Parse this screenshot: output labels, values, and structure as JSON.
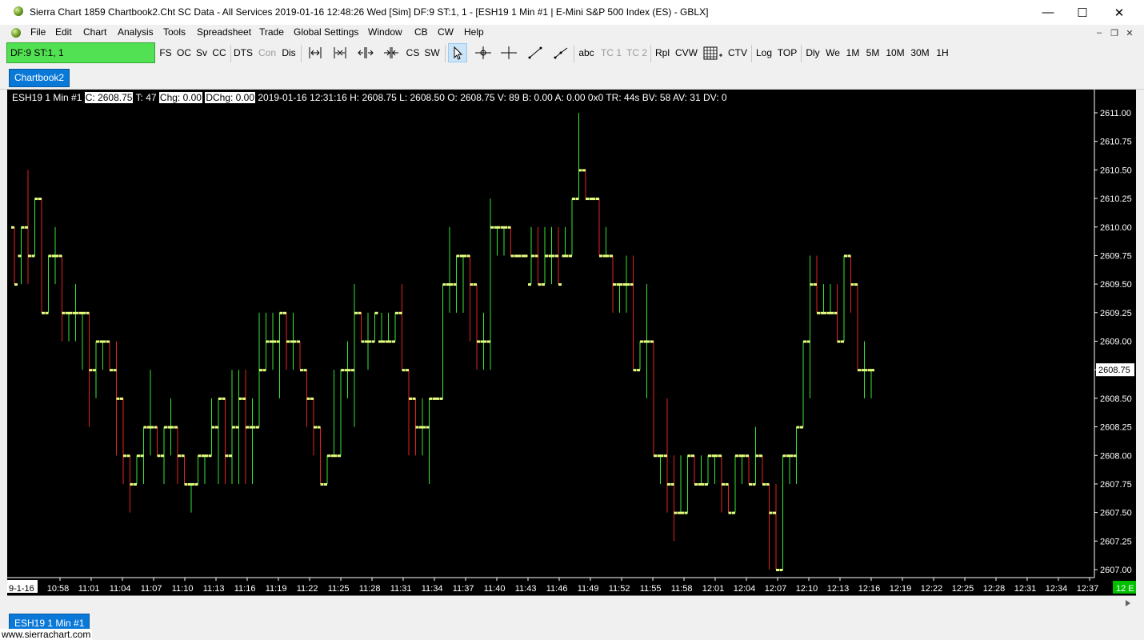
{
  "window": {
    "title": "Sierra Chart 1859 Chartbook2.Cht  SC Data - All Services 2019-01-16  12:48:26 Wed [Sim]  DF:9  ST:1, 1 - [ESH19  1 Min  #1 | E-Mini S&P 500 Index (ES) - GBLX]",
    "controls": {
      "minimize": "—",
      "maximize": "☐",
      "close": "✕"
    }
  },
  "menu": [
    "File",
    "Edit",
    "Chart",
    "Analysis",
    "Tools",
    "Spreadsheet",
    "Trade",
    "Global Settings",
    "Window",
    "CB",
    "CW",
    "Help"
  ],
  "mdi_controls": {
    "minimize": "–",
    "restore": "❐",
    "close": "✕"
  },
  "toolbar": {
    "df_status": "DF:9  ST:1, 1",
    "group1": [
      "FS",
      "OC",
      "Sv",
      "CC"
    ],
    "group2": [
      "DTS",
      "Con",
      "Dis"
    ],
    "group3": [
      "CS",
      "SW"
    ],
    "group4": [
      "abc",
      "TC 1",
      "TC 2"
    ],
    "group5": [
      "Rpl",
      "CVW"
    ],
    "group6": [
      "CTV"
    ],
    "group7": [
      "Log",
      "TOP"
    ],
    "group8": [
      "Dly",
      "We",
      "1M",
      "5M",
      "10M",
      "30M",
      "1H"
    ]
  },
  "tab": {
    "label": "Chartbook2"
  },
  "info_line": {
    "symbol": "ESH19  1 Min   #1",
    "close": "C: 2608.75",
    "ticks": " T: 47 ",
    "chg": "Chg: 0.00",
    "dchg": "DChg: 0.00",
    "rest": " 2019-01-16 12:31:16 H: 2608.75  L: 2608.50  O: 2608.75  V: 89  B: 0.00  A: 0.00 0x0  TR: 44s  BV: 58  AV: 31  DV: 0"
  },
  "bottom_tab": {
    "label": "ESH19  1 Min   #1"
  },
  "status_bar": {
    "url": "www.sierrachart.com"
  },
  "colors": {
    "chart_bg": "#000000",
    "up": "#33e633",
    "down": "#e62020",
    "tick": "#e6ff80",
    "axis_text": "#ffffff",
    "price_marker_bg": "#ffffff",
    "corner_badge": "#00c000",
    "df_box": "#52e152",
    "tab_active": "#0a78d7"
  },
  "chart_data": {
    "type": "ohlc",
    "symbol": "ESH19",
    "interval": "1 Min",
    "ylim": [
      2607.0,
      2611.0
    ],
    "y_ticks": [
      "2611.00",
      "2610.75",
      "2610.50",
      "2610.25",
      "2610.00",
      "2609.75",
      "2609.50",
      "2609.25",
      "2609.00",
      "2608.75",
      "2608.50",
      "2608.25",
      "2608.00",
      "2607.75",
      "2607.50",
      "2607.25",
      "2607.00"
    ],
    "current_price_label": "2608.75",
    "x_ticks": [
      "9-1-16",
      "10:58",
      "11:01",
      "11:04",
      "11:07",
      "11:10",
      "11:13",
      "11:16",
      "11:19",
      "11:22",
      "11:25",
      "11:28",
      "11:31",
      "11:34",
      "11:37",
      "11:40",
      "11:43",
      "11:46",
      "11:49",
      "11:52",
      "11:55",
      "11:58",
      "12:01",
      "12:04",
      "12:07",
      "12:10",
      "12:13",
      "12:16",
      "12:19",
      "12:22",
      "12:25",
      "12:28",
      "12:31",
      "12:34",
      "12:37"
    ],
    "corner_badge": "12 E",
    "bars": [
      {
        "o": 2610.0,
        "h": 2610.0,
        "l": 2609.5,
        "c": 2609.5
      },
      {
        "o": 2609.75,
        "h": 2610.0,
        "l": 2609.5,
        "c": 2610.0
      },
      {
        "o": 2610.0,
        "h": 2610.5,
        "l": 2609.5,
        "c": 2609.75
      },
      {
        "o": 2609.75,
        "h": 2610.25,
        "l": 2609.75,
        "c": 2610.25
      },
      {
        "o": 2610.25,
        "h": 2610.25,
        "l": 2609.25,
        "c": 2609.25
      },
      {
        "o": 2609.25,
        "h": 2609.75,
        "l": 2609.25,
        "c": 2609.75
      },
      {
        "o": 2609.75,
        "h": 2610.0,
        "l": 2609.5,
        "c": 2609.75
      },
      {
        "o": 2609.75,
        "h": 2609.75,
        "l": 2609.0,
        "c": 2609.25
      },
      {
        "o": 2609.25,
        "h": 2609.25,
        "l": 2609.0,
        "c": 2609.25
      },
      {
        "o": 2609.25,
        "h": 2609.5,
        "l": 2609.0,
        "c": 2609.25
      },
      {
        "o": 2609.25,
        "h": 2609.25,
        "l": 2608.75,
        "c": 2609.25
      },
      {
        "o": 2609.25,
        "h": 2609.25,
        "l": 2608.25,
        "c": 2608.75
      },
      {
        "o": 2608.75,
        "h": 2609.0,
        "l": 2608.5,
        "c": 2609.0
      },
      {
        "o": 2609.0,
        "h": 2609.0,
        "l": 2608.75,
        "c": 2609.0
      },
      {
        "o": 2609.0,
        "h": 2609.0,
        "l": 2608.75,
        "c": 2608.75
      },
      {
        "o": 2608.75,
        "h": 2609.0,
        "l": 2608.0,
        "c": 2608.5
      },
      {
        "o": 2608.5,
        "h": 2608.5,
        "l": 2607.75,
        "c": 2608.0
      },
      {
        "o": 2608.0,
        "h": 2608.0,
        "l": 2607.5,
        "c": 2607.75
      },
      {
        "o": 2607.75,
        "h": 2608.0,
        "l": 2607.75,
        "c": 2608.0
      },
      {
        "o": 2608.0,
        "h": 2608.25,
        "l": 2607.75,
        "c": 2608.25
      },
      {
        "o": 2608.25,
        "h": 2608.75,
        "l": 2608.0,
        "c": 2608.25
      },
      {
        "o": 2608.25,
        "h": 2608.25,
        "l": 2608.0,
        "c": 2608.0
      },
      {
        "o": 2608.0,
        "h": 2608.25,
        "l": 2607.75,
        "c": 2608.25
      },
      {
        "o": 2608.25,
        "h": 2608.5,
        "l": 2608.0,
        "c": 2608.25
      },
      {
        "o": 2608.25,
        "h": 2608.25,
        "l": 2607.75,
        "c": 2608.0
      },
      {
        "o": 2608.0,
        "h": 2608.0,
        "l": 2607.75,
        "c": 2607.75
      },
      {
        "o": 2607.75,
        "h": 2607.75,
        "l": 2607.5,
        "c": 2607.75
      },
      {
        "o": 2607.75,
        "h": 2608.0,
        "l": 2607.75,
        "c": 2608.0
      },
      {
        "o": 2608.0,
        "h": 2608.0,
        "l": 2607.75,
        "c": 2608.0
      },
      {
        "o": 2608.0,
        "h": 2608.5,
        "l": 2608.0,
        "c": 2608.25
      },
      {
        "o": 2608.25,
        "h": 2608.5,
        "l": 2607.75,
        "c": 2608.5
      },
      {
        "o": 2608.5,
        "h": 2608.5,
        "l": 2607.75,
        "c": 2608.0
      },
      {
        "o": 2608.0,
        "h": 2608.75,
        "l": 2607.75,
        "c": 2608.25
      },
      {
        "o": 2608.25,
        "h": 2608.75,
        "l": 2607.75,
        "c": 2608.5
      },
      {
        "o": 2608.5,
        "h": 2608.75,
        "l": 2607.75,
        "c": 2608.25
      },
      {
        "o": 2608.25,
        "h": 2608.5,
        "l": 2607.75,
        "c": 2608.25
      },
      {
        "o": 2608.25,
        "h": 2609.25,
        "l": 2608.25,
        "c": 2608.75
      },
      {
        "o": 2608.75,
        "h": 2609.25,
        "l": 2608.75,
        "c": 2609.0
      },
      {
        "o": 2609.0,
        "h": 2609.25,
        "l": 2608.75,
        "c": 2609.0
      },
      {
        "o": 2609.0,
        "h": 2609.25,
        "l": 2608.5,
        "c": 2609.25
      },
      {
        "o": 2609.25,
        "h": 2609.25,
        "l": 2608.75,
        "c": 2609.0
      },
      {
        "o": 2609.0,
        "h": 2609.25,
        "l": 2608.75,
        "c": 2609.0
      },
      {
        "o": 2609.0,
        "h": 2609.0,
        "l": 2608.75,
        "c": 2608.75
      },
      {
        "o": 2608.75,
        "h": 2608.75,
        "l": 2608.25,
        "c": 2608.5
      },
      {
        "o": 2608.5,
        "h": 2608.5,
        "l": 2608.0,
        "c": 2608.25
      },
      {
        "o": 2608.25,
        "h": 2608.25,
        "l": 2607.75,
        "c": 2607.75
      },
      {
        "o": 2607.75,
        "h": 2608.0,
        "l": 2607.75,
        "c": 2608.0
      },
      {
        "o": 2608.0,
        "h": 2608.75,
        "l": 2608.0,
        "c": 2608.0
      },
      {
        "o": 2608.0,
        "h": 2608.75,
        "l": 2608.0,
        "c": 2608.75
      },
      {
        "o": 2608.75,
        "h": 2609.0,
        "l": 2608.5,
        "c": 2608.75
      },
      {
        "o": 2608.75,
        "h": 2609.5,
        "l": 2608.25,
        "c": 2609.25
      },
      {
        "o": 2609.25,
        "h": 2609.25,
        "l": 2609.0,
        "c": 2609.0
      },
      {
        "o": 2609.0,
        "h": 2609.25,
        "l": 2608.75,
        "c": 2609.0
      },
      {
        "o": 2609.0,
        "h": 2609.25,
        "l": 2609.0,
        "c": 2609.25
      },
      {
        "o": 2609.0,
        "h": 2609.25,
        "l": 2609.0,
        "c": 2609.0
      },
      {
        "o": 2609.0,
        "h": 2609.25,
        "l": 2609.0,
        "c": 2609.0
      },
      {
        "o": 2609.0,
        "h": 2609.25,
        "l": 2609.0,
        "c": 2609.25
      },
      {
        "o": 2609.25,
        "h": 2609.5,
        "l": 2608.75,
        "c": 2608.75
      },
      {
        "o": 2608.75,
        "h": 2608.75,
        "l": 2608.0,
        "c": 2608.5
      },
      {
        "o": 2608.5,
        "h": 2608.5,
        "l": 2608.0,
        "c": 2608.25
      },
      {
        "o": 2608.25,
        "h": 2608.5,
        "l": 2608.0,
        "c": 2608.25
      },
      {
        "o": 2608.25,
        "h": 2608.5,
        "l": 2607.75,
        "c": 2608.5
      },
      {
        "o": 2608.5,
        "h": 2608.5,
        "l": 2608.5,
        "c": 2608.5
      },
      {
        "o": 2608.5,
        "h": 2609.5,
        "l": 2608.5,
        "c": 2609.5
      },
      {
        "o": 2609.5,
        "h": 2610.0,
        "l": 2609.25,
        "c": 2609.5
      },
      {
        "o": 2609.5,
        "h": 2609.75,
        "l": 2609.25,
        "c": 2609.75
      },
      {
        "o": 2609.75,
        "h": 2609.75,
        "l": 2609.25,
        "c": 2609.75
      },
      {
        "o": 2609.75,
        "h": 2609.75,
        "l": 2609.0,
        "c": 2609.5
      },
      {
        "o": 2609.5,
        "h": 2609.5,
        "l": 2608.75,
        "c": 2609.0
      },
      {
        "o": 2609.0,
        "h": 2609.25,
        "l": 2608.75,
        "c": 2609.0
      },
      {
        "o": 2609.0,
        "h": 2610.25,
        "l": 2608.75,
        "c": 2610.0
      },
      {
        "o": 2610.0,
        "h": 2610.0,
        "l": 2609.75,
        "c": 2610.0
      },
      {
        "o": 2610.0,
        "h": 2610.0,
        "l": 2609.75,
        "c": 2610.0
      },
      {
        "o": 2610.0,
        "h": 2610.0,
        "l": 2609.75,
        "c": 2609.75
      },
      {
        "o": 2609.75,
        "h": 2609.75,
        "l": 2609.75,
        "c": 2609.75
      },
      {
        "o": 2609.75,
        "h": 2609.75,
        "l": 2609.75,
        "c": 2609.75
      },
      {
        "o": 2609.5,
        "h": 2610.0,
        "l": 2609.5,
        "c": 2609.75
      },
      {
        "o": 2609.75,
        "h": 2610.0,
        "l": 2609.5,
        "c": 2609.5
      },
      {
        "o": 2609.5,
        "h": 2610.0,
        "l": 2609.5,
        "c": 2609.75
      },
      {
        "o": 2609.75,
        "h": 2610.0,
        "l": 2609.5,
        "c": 2609.75
      },
      {
        "o": 2609.75,
        "h": 2610.0,
        "l": 2609.5,
        "c": 2609.5
      },
      {
        "o": 2609.75,
        "h": 2610.0,
        "l": 2609.75,
        "c": 2609.75
      },
      {
        "o": 2609.75,
        "h": 2610.25,
        "l": 2609.75,
        "c": 2610.25
      },
      {
        "o": 2610.25,
        "h": 2611.0,
        "l": 2610.25,
        "c": 2610.5
      },
      {
        "o": 2610.5,
        "h": 2610.5,
        "l": 2610.25,
        "c": 2610.25
      },
      {
        "o": 2610.25,
        "h": 2610.25,
        "l": 2610.25,
        "c": 2610.25
      },
      {
        "o": 2610.25,
        "h": 2610.25,
        "l": 2609.75,
        "c": 2609.75
      },
      {
        "o": 2609.75,
        "h": 2610.0,
        "l": 2609.75,
        "c": 2609.75
      },
      {
        "o": 2609.75,
        "h": 2609.75,
        "l": 2609.25,
        "c": 2609.5
      },
      {
        "o": 2609.5,
        "h": 2609.5,
        "l": 2609.25,
        "c": 2609.5
      },
      {
        "o": 2609.5,
        "h": 2609.75,
        "l": 2609.25,
        "c": 2609.5
      },
      {
        "o": 2609.5,
        "h": 2609.75,
        "l": 2608.75,
        "c": 2608.75
      },
      {
        "o": 2608.75,
        "h": 2609.0,
        "l": 2608.75,
        "c": 2609.0
      },
      {
        "o": 2609.0,
        "h": 2609.5,
        "l": 2608.5,
        "c": 2609.0
      },
      {
        "o": 2609.0,
        "h": 2609.0,
        "l": 2608.0,
        "c": 2608.0
      },
      {
        "o": 2608.0,
        "h": 2608.0,
        "l": 2607.75,
        "c": 2608.0
      },
      {
        "o": 2608.0,
        "h": 2608.5,
        "l": 2607.5,
        "c": 2607.75
      },
      {
        "o": 2607.75,
        "h": 2608.0,
        "l": 2607.25,
        "c": 2607.5
      },
      {
        "o": 2607.5,
        "h": 2608.0,
        "l": 2607.5,
        "c": 2607.5
      },
      {
        "o": 2607.5,
        "h": 2608.0,
        "l": 2607.5,
        "c": 2608.0
      },
      {
        "o": 2608.0,
        "h": 2608.0,
        "l": 2607.75,
        "c": 2607.75
      },
      {
        "o": 2607.75,
        "h": 2608.0,
        "l": 2607.75,
        "c": 2607.75
      },
      {
        "o": 2607.75,
        "h": 2608.0,
        "l": 2607.75,
        "c": 2608.0
      },
      {
        "o": 2608.0,
        "h": 2608.0,
        "l": 2607.75,
        "c": 2608.0
      },
      {
        "o": 2608.0,
        "h": 2608.0,
        "l": 2607.5,
        "c": 2607.75
      },
      {
        "o": 2607.75,
        "h": 2607.75,
        "l": 2607.5,
        "c": 2607.5
      },
      {
        "o": 2607.5,
        "h": 2608.0,
        "l": 2607.5,
        "c": 2608.0
      },
      {
        "o": 2608.0,
        "h": 2608.0,
        "l": 2607.75,
        "c": 2608.0
      },
      {
        "o": 2608.0,
        "h": 2608.0,
        "l": 2607.75,
        "c": 2607.75
      },
      {
        "o": 2607.75,
        "h": 2608.25,
        "l": 2607.75,
        "c": 2608.0
      },
      {
        "o": 2608.0,
        "h": 2608.0,
        "l": 2607.75,
        "c": 2607.75
      },
      {
        "o": 2607.75,
        "h": 2607.75,
        "l": 2607.0,
        "c": 2607.5
      },
      {
        "o": 2607.5,
        "h": 2607.75,
        "l": 2607.0,
        "c": 2607.0
      },
      {
        "o": 2607.0,
        "h": 2608.0,
        "l": 2607.0,
        "c": 2608.0
      },
      {
        "o": 2608.0,
        "h": 2608.0,
        "l": 2607.75,
        "c": 2608.0
      },
      {
        "o": 2608.0,
        "h": 2608.25,
        "l": 2607.75,
        "c": 2608.25
      },
      {
        "o": 2608.25,
        "h": 2609.0,
        "l": 2608.25,
        "c": 2609.0
      },
      {
        "o": 2609.0,
        "h": 2609.75,
        "l": 2608.5,
        "c": 2609.5
      },
      {
        "o": 2609.5,
        "h": 2609.75,
        "l": 2609.25,
        "c": 2609.25
      },
      {
        "o": 2609.25,
        "h": 2609.5,
        "l": 2609.25,
        "c": 2609.25
      },
      {
        "o": 2609.25,
        "h": 2609.5,
        "l": 2609.25,
        "c": 2609.25
      },
      {
        "o": 2609.25,
        "h": 2609.5,
        "l": 2609.0,
        "c": 2609.0
      },
      {
        "o": 2609.0,
        "h": 2609.75,
        "l": 2609.0,
        "c": 2609.75
      },
      {
        "o": 2609.75,
        "h": 2609.75,
        "l": 2609.25,
        "c": 2609.5
      },
      {
        "o": 2609.5,
        "h": 2609.5,
        "l": 2608.75,
        "c": 2608.75
      },
      {
        "o": 2608.75,
        "h": 2609.0,
        "l": 2608.5,
        "c": 2608.75
      },
      {
        "o": 2608.75,
        "h": 2608.75,
        "l": 2608.5,
        "c": 2608.75
      }
    ]
  }
}
